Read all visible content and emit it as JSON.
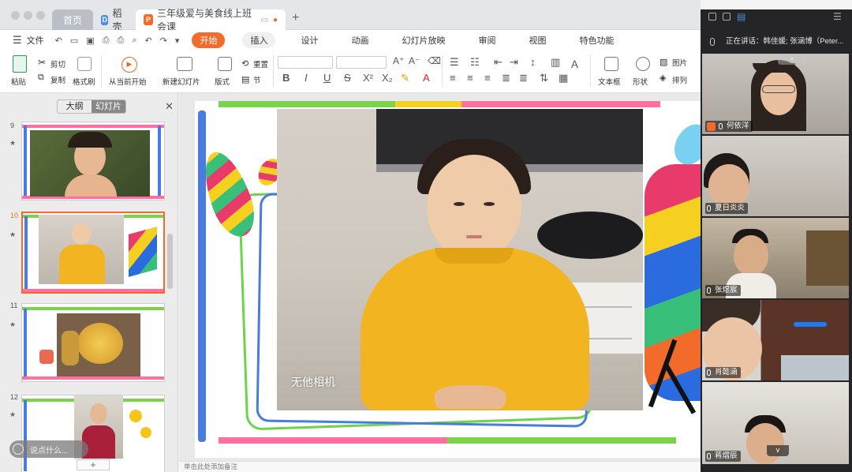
{
  "tabs": {
    "home": "首页",
    "daoke": "稻壳",
    "document": "三年级爱与美食线上班会课"
  },
  "menu": {
    "file": "文件",
    "items": [
      "开始",
      "插入",
      "设计",
      "动画",
      "幻灯片放映",
      "审阅",
      "视图",
      "特色功能"
    ]
  },
  "ribbon": {
    "paste": "粘贴",
    "cut": "剪切",
    "copy": "复制",
    "format_painter": "格式刷",
    "play_from_current": "从当前开始",
    "new_slide": "新建幻灯片",
    "layout": "版式",
    "reset": "重置",
    "section": "节",
    "textbox": "文本框",
    "shape": "形状",
    "picture": "图片",
    "arrange": "排列"
  },
  "panel": {
    "outline_tab": "大纲",
    "slides_tab": "幻灯片",
    "slide_numbers": [
      "9",
      "10",
      "11",
      "12"
    ],
    "chat_placeholder": "说点什么...",
    "add_slide": "+"
  },
  "slide": {
    "watermark": "无他相机"
  },
  "notes_placeholder": "单击此处添加备注",
  "meeting": {
    "speaking": "正在讲话：韩佳媛; 张涵博（Peter...",
    "participants": [
      "何依洋",
      "夏日炎炎",
      "张煜宸",
      "肖懿涵",
      "蒋熠辰"
    ]
  },
  "colors": {
    "accent": "#f36b2b",
    "yellow_sweater": "#f2b420",
    "meeting_bg": "#252528"
  }
}
